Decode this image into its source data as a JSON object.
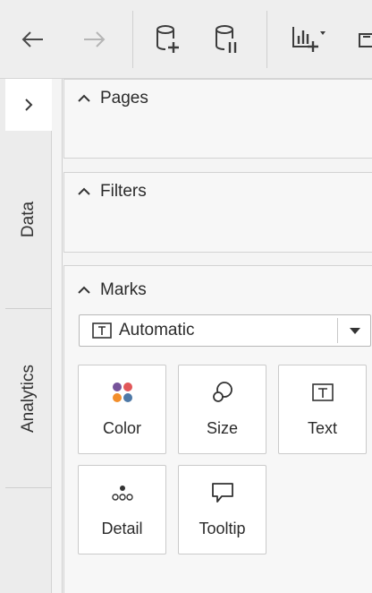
{
  "toolbar": {
    "back_icon": "arrow-left-icon",
    "forward_icon": "arrow-right-icon",
    "new_data_source_icon": "database-add-icon",
    "pause_updates_icon": "database-pause-icon",
    "show_me_icon": "chart-add-icon"
  },
  "rail": {
    "toggle_icon": "chevron-right-icon",
    "tabs": [
      {
        "label": "Data"
      },
      {
        "label": "Analytics"
      }
    ]
  },
  "cards": {
    "pages": {
      "title": "Pages"
    },
    "filters": {
      "title": "Filters"
    },
    "marks": {
      "title": "Marks",
      "mark_type": "Automatic",
      "tiles": [
        {
          "label": "Color",
          "icon": "color-dots-icon"
        },
        {
          "label": "Size",
          "icon": "size-icon"
        },
        {
          "label": "Text",
          "icon": "text-box-icon"
        },
        {
          "label": "Detail",
          "icon": "detail-dots-icon"
        },
        {
          "label": "Tooltip",
          "icon": "tooltip-icon"
        }
      ]
    }
  },
  "colors": {
    "accent_blue": "#4e79a7",
    "accent_orange": "#f28e2b",
    "accent_red": "#e15759",
    "accent_purple": "#76539a"
  }
}
